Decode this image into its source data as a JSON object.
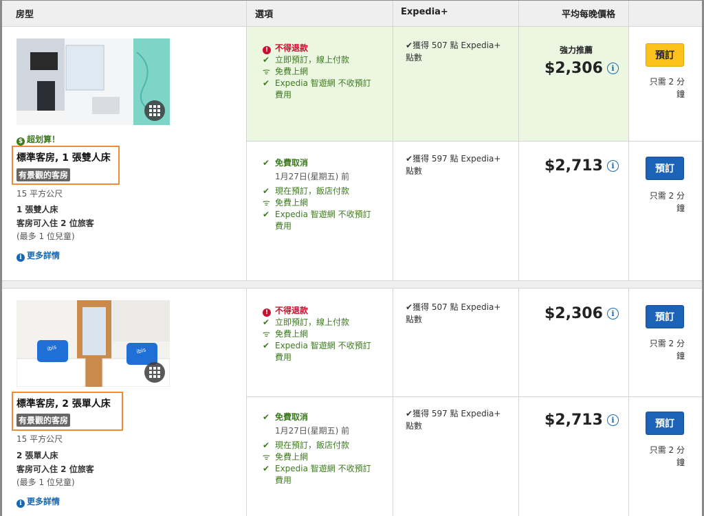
{
  "header": {
    "room_type": "房型",
    "options": "選項",
    "expedia_plus": "Expedia+",
    "avg_price": "平均每晚價格"
  },
  "rooms": [
    {
      "deal": "超划算！",
      "title": "標準客房, 1 張雙人床",
      "view_badge": "有景觀的客房",
      "size": "15 平方公尺",
      "bed": "1 張雙人床",
      "capacity": "客房可入住 2 位旅客",
      "children": "(最多 1 位兒童)",
      "more": "更多詳情",
      "rates": [
        {
          "cancel": "不得退款",
          "pay": "立即預訂，線上付款",
          "wifi": "免費上網",
          "vip_1": "Expedia 智遊網 不收預訂",
          "vip_2": "費用",
          "points_1": "獲得 507 點 Expedia+",
          "points_2": "點數",
          "recommend": "強力推薦",
          "price": "$2,306",
          "book": "預訂",
          "note_1": "只需 2 分",
          "note_2": "鐘"
        },
        {
          "cancel": "免費取消",
          "date": "1月27日(星期五) 前",
          "pay": "現在預訂，飯店付款",
          "wifi": "免費上網",
          "vip_1": "Expedia 智遊網 不收預訂",
          "vip_2": "費用",
          "points_1": "獲得 597 點 Expedia+",
          "points_2": "點數",
          "price": "$2,713",
          "book": "預訂",
          "note_1": "只需 2 分",
          "note_2": "鐘"
        }
      ]
    },
    {
      "title": "標準客房, 2 張單人床",
      "view_badge": "有景觀的客房",
      "size": "15 平方公尺",
      "bed": "2 張單人床",
      "capacity": "客房可入住 2 位旅客",
      "children": "(最多 1 位兒童)",
      "more": "更多詳情",
      "pillow_brand": "ibis budget",
      "rates": [
        {
          "cancel": "不得退款",
          "pay": "立即預訂，線上付款",
          "wifi": "免費上網",
          "vip_1": "Expedia 智遊網 不收預訂",
          "vip_2": "費用",
          "points_1": "獲得 507 點 Expedia+",
          "points_2": "點數",
          "price": "$2,306",
          "book": "預訂",
          "note_1": "只需 2 分",
          "note_2": "鐘"
        },
        {
          "cancel": "免費取消",
          "date": "1月27日(星期五) 前",
          "pay": "現在預訂，飯店付款",
          "wifi": "免費上網",
          "vip_1": "Expedia 智遊網 不收預訂",
          "vip_2": "費用",
          "points_1": "獲得 597 點 Expedia+",
          "points_2": "點數",
          "price": "$2,713",
          "book": "預訂",
          "note_1": "只需 2 分",
          "note_2": "鐘"
        }
      ]
    }
  ],
  "colors": {
    "green_text": "#3c7a1e",
    "red_text": "#c8102e",
    "highlight_bg": "#ecf7e2",
    "blue_button": "#1c63b8",
    "yellow_button": "#fcc21b",
    "orange_outline": "#f28a30",
    "link_blue": "#1668b5"
  }
}
